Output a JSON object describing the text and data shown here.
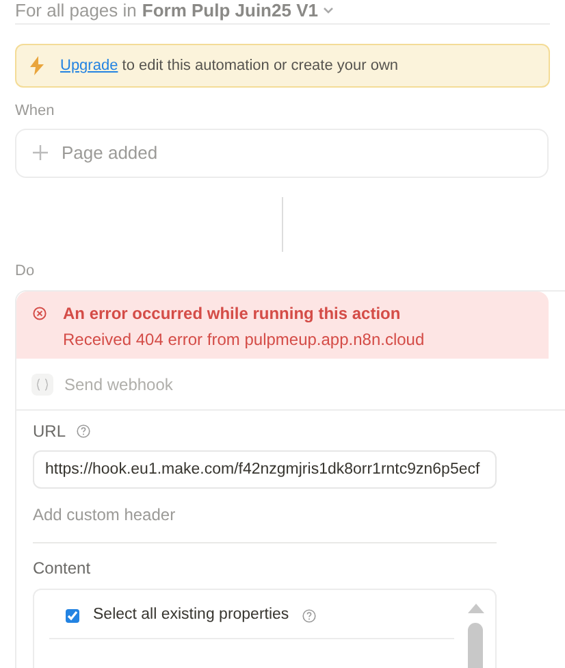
{
  "scope": {
    "prefix": "For all pages in",
    "database": "Form Pulp Juin25 V1"
  },
  "banner": {
    "link": "Upgrade",
    "rest": "to edit this automation or create your own"
  },
  "when": {
    "label": "When",
    "trigger": "Page added"
  },
  "do": {
    "label": "Do",
    "error": {
      "title": "An error occurred while running this action",
      "detail": "Received 404 error from pulpmeup.app.n8n.cloud"
    },
    "action": "Send webhook",
    "url": {
      "label": "URL",
      "value": "https://hook.eu1.make.com/f42nzgmjris1dk8orr1rntc9zn6p5ecf"
    },
    "custom_header": "Add custom header",
    "content": {
      "label": "Content",
      "select_all": {
        "label": "Select all existing properties",
        "checked": true
      }
    }
  }
}
